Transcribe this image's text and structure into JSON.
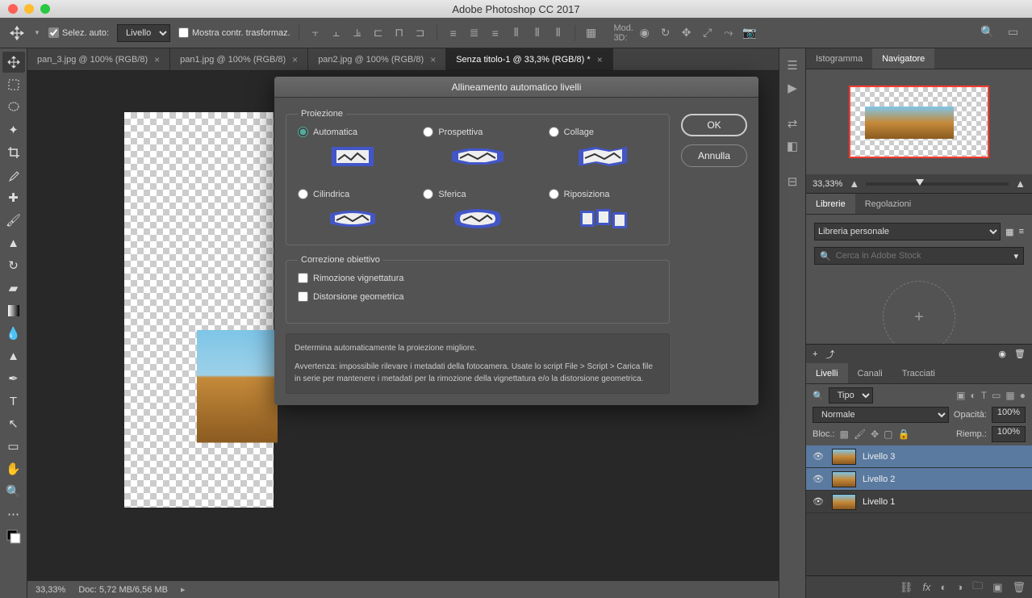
{
  "app_title": "Adobe Photoshop CC 2017",
  "optionbar": {
    "auto_select_label": "Selez. auto:",
    "auto_select_dropdown": "Livello",
    "show_transform_label": "Mostra contr. trasformaz.",
    "mod3d_label": "Mod. 3D:"
  },
  "doc_tabs": [
    {
      "label": "pan_3.jpg @ 100% (RGB/8)",
      "active": false
    },
    {
      "label": "pan1.jpg @ 100% (RGB/8)",
      "active": false
    },
    {
      "label": "pan2.jpg @ 100% (RGB/8)",
      "active": false
    },
    {
      "label": "Senza titolo-1 @ 33,3% (RGB/8) *",
      "active": true
    }
  ],
  "statusbar": {
    "zoom": "33,33%",
    "doc": "Doc: 5,72 MB/6,56 MB"
  },
  "panels": {
    "histogram_tab": "Istogramma",
    "navigator_tab": "Navigatore",
    "navigator_zoom": "33,33%",
    "libraries_tab": "Librerie",
    "adjustments_tab": "Regolazioni",
    "library_select": "Libreria personale",
    "library_search_placeholder": "Cerca in Adobe Stock",
    "layers_tab": "Livelli",
    "channels_tab": "Canali",
    "paths_tab": "Tracciati",
    "layers_kind": "Tipo",
    "blend_mode": "Normale",
    "opacity_label": "Opacità:",
    "opacity_value": "100%",
    "lock_label": "Bloc.:",
    "fill_label": "Riemp.:",
    "fill_value": "100%",
    "layers": [
      {
        "name": "Livello 3",
        "visible": true,
        "selected": true
      },
      {
        "name": "Livello 2",
        "visible": true,
        "selected": true
      },
      {
        "name": "Livello 1",
        "visible": true,
        "selected": false
      }
    ]
  },
  "dialog": {
    "title": "Allineamento automatico livelli",
    "ok": "OK",
    "cancel": "Annulla",
    "projection_legend": "Proiezione",
    "options": {
      "auto": "Automatica",
      "perspective": "Prospettiva",
      "collage": "Collage",
      "cylindrical": "Cilindrica",
      "spherical": "Sferica",
      "reposition": "Riposiziona"
    },
    "selected_option": "auto",
    "lens_legend": "Correzione obiettivo",
    "vignette_label": "Rimozione vignettatura",
    "geometric_label": "Distorsione geometrica",
    "desc_line1": "Determina automaticamente la proiezione migliore.",
    "desc_line2": "Avvertenza: impossibile rilevare i metadati della fotocamera. Usate lo script File > Script > Carica file in serie per mantenere i metadati per la rimozione della vignettatura e/o la distorsione geometrica."
  }
}
